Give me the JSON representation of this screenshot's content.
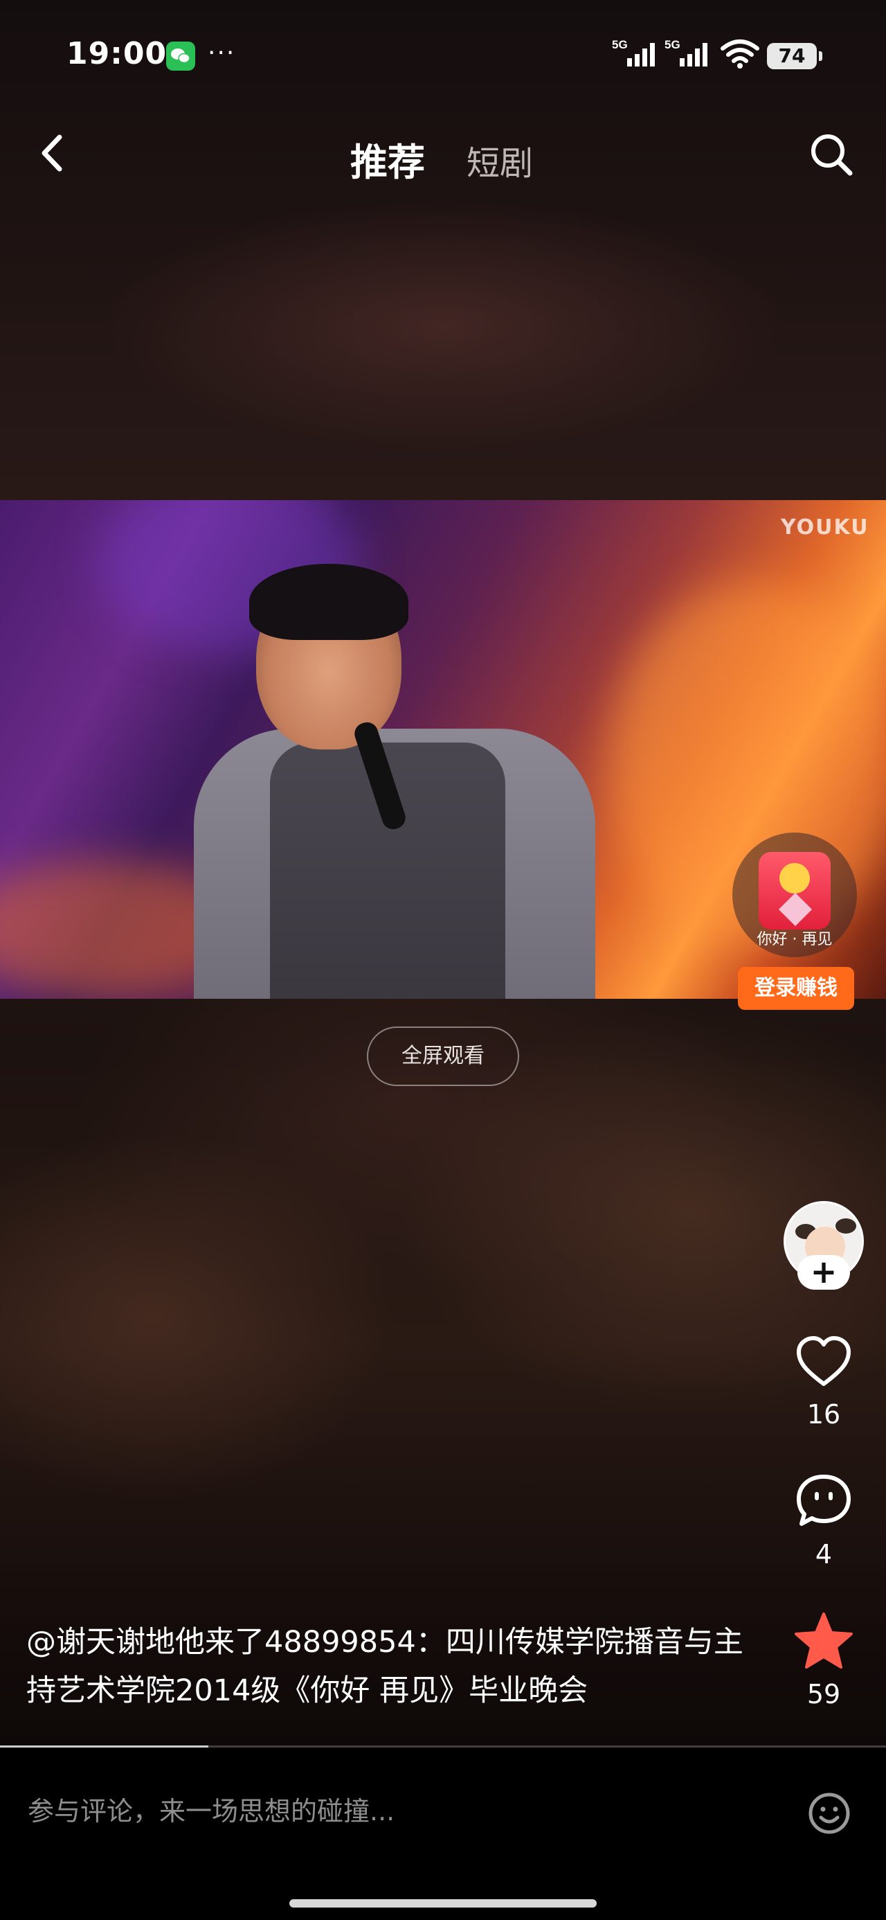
{
  "status_bar": {
    "time": "19:00",
    "more": "···",
    "network_1": "5G",
    "network_2": "5G",
    "battery": "74"
  },
  "nav": {
    "tabs": [
      "推荐",
      "短剧"
    ],
    "active_tab": "推荐"
  },
  "video": {
    "watermark": "YOUKU",
    "fullscreen_label": "全屏观看",
    "progress": 0.235
  },
  "promo": {
    "caption": "你好 · 再见",
    "button_label": "登录赚钱"
  },
  "actions": {
    "likes": "16",
    "comments": "4",
    "favorites": "59"
  },
  "caption": {
    "text": "@谢天谢地他来了48899854：四川传媒学院播音与主持艺术学院2014级《你好 再见》毕业晚会"
  },
  "comment_bar": {
    "placeholder": "参与评论，来一场思想的碰撞..."
  },
  "colors": {
    "accent_orange": "#ff6a1a",
    "favorite_star": "#ff5a4a"
  },
  "icons": {
    "back": "chevron-left-icon",
    "search": "search-icon",
    "like": "heart-icon",
    "comment": "comment-bubble-icon",
    "favorite": "star-icon",
    "emoji": "emoji-icon",
    "follow": "plus-icon"
  }
}
